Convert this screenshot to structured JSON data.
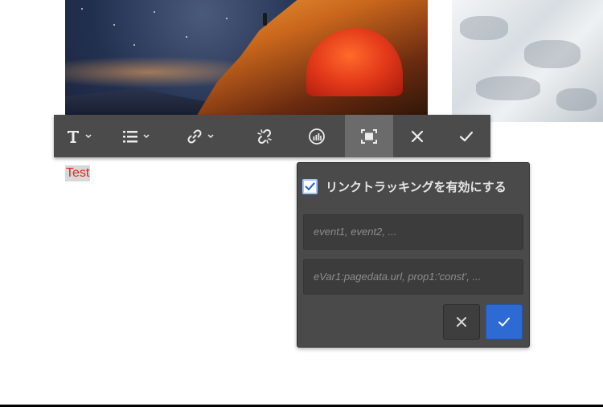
{
  "images": {
    "camp": {
      "icon": "photo-camping-tent-night"
    },
    "snow": {
      "icon": "photo-snowy-glacier"
    }
  },
  "toolbar": {
    "items": [
      {
        "icon": "text-format-icon",
        "has_dropdown": true
      },
      {
        "icon": "list-icon",
        "has_dropdown": true
      },
      {
        "icon": "link-icon",
        "has_dropdown": true
      },
      {
        "icon": "unlink-icon",
        "has_dropdown": false
      },
      {
        "icon": "analytics-icon",
        "has_dropdown": false
      },
      {
        "icon": "fullscreen-icon",
        "has_dropdown": false,
        "active": true
      },
      {
        "icon": "close-icon",
        "has_dropdown": false
      },
      {
        "icon": "checkmark-icon",
        "has_dropdown": false
      }
    ]
  },
  "content": {
    "selected_text": "Test"
  },
  "link_tracking": {
    "checkbox_label": "リンクトラッキングを有効にする",
    "checked": true,
    "events_placeholder": "event1, event2, ...",
    "events_value": "",
    "vars_placeholder": "eVar1:pagedata.url, prop1:'const', ...",
    "vars_value": "",
    "cancel_icon": "close-icon",
    "confirm_icon": "checkmark-icon"
  },
  "colors": {
    "accent": "#2d6ad3",
    "toolbar_bg": "#4b4b4b",
    "popover_bg": "#4a4a4a",
    "text_red": "#e1251b"
  }
}
